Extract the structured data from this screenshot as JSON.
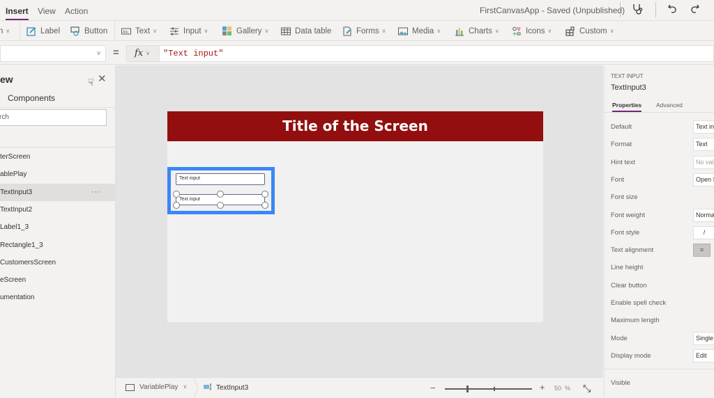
{
  "menu": {
    "tabs": [
      {
        "label": "Insert",
        "active": true
      },
      {
        "label": "View",
        "active": false
      },
      {
        "label": "Action",
        "active": false
      }
    ],
    "app_title": "FirstCanvasApp - Saved (Unpublished)",
    "icons": [
      "stethoscope-icon",
      "undo-icon",
      "redo-icon"
    ]
  },
  "ribbon": {
    "items": [
      {
        "label": "n",
        "dropdown": true,
        "icon": "new-screen-icon"
      },
      {
        "label": "Label",
        "dropdown": false,
        "icon": "label-icon"
      },
      {
        "label": "Button",
        "dropdown": false,
        "icon": "button-icon"
      },
      {
        "label": "Text",
        "dropdown": true,
        "icon": "text-icon"
      },
      {
        "label": "Input",
        "dropdown": true,
        "icon": "input-icon"
      },
      {
        "label": "Gallery",
        "dropdown": true,
        "icon": "gallery-icon"
      },
      {
        "label": "Data table",
        "dropdown": false,
        "icon": "data-table-icon"
      },
      {
        "label": "Forms",
        "dropdown": true,
        "icon": "forms-icon"
      },
      {
        "label": "Media",
        "dropdown": true,
        "icon": "media-icon"
      },
      {
        "label": "Charts",
        "dropdown": true,
        "icon": "charts-icon"
      },
      {
        "label": "Icons",
        "dropdown": true,
        "icon": "icons-icon"
      },
      {
        "label": "Custom",
        "dropdown": true,
        "icon": "custom-icon"
      }
    ]
  },
  "formula_bar": {
    "property_value": "",
    "equals": "=",
    "fx_label": "fx",
    "formula": "\"Text input\""
  },
  "tree_view": {
    "title": "ew",
    "tab_components": "Components",
    "search_placeholder": "rch",
    "items": [
      {
        "label": "terScreen",
        "selected": false
      },
      {
        "label": "ablePlay",
        "selected": false
      },
      {
        "label": "TextInput3",
        "selected": true
      },
      {
        "label": "TextInput2",
        "selected": false
      },
      {
        "label": "Label1_3",
        "selected": false
      },
      {
        "label": "Rectangle1_3",
        "selected": false
      },
      {
        "label": "CustomersScreen",
        "selected": false
      },
      {
        "label": "eScreen",
        "selected": false
      },
      {
        "label": "umentation",
        "selected": false
      }
    ],
    "more_label": "···"
  },
  "canvas": {
    "screen_title": "Title of the Screen",
    "title_color": "#930e0e",
    "selection_color": "#3b87f5",
    "text_input_1": "Text input",
    "text_input_2": "Text input"
  },
  "status_bar": {
    "screen_name": "VariablePlay",
    "selected_control": "TextInput3",
    "zoom_value": "50",
    "zoom_unit": "%",
    "zoom_percent": 50
  },
  "properties": {
    "control_type": "TEXT INPUT",
    "control_name": "TextInput3",
    "tabs": [
      {
        "label": "Properties",
        "active": true
      },
      {
        "label": "Advanced",
        "active": false
      }
    ],
    "rows": [
      {
        "label": "Default",
        "value": "Text in",
        "kind": "input"
      },
      {
        "label": "Format",
        "value": "Text",
        "kind": "input"
      },
      {
        "label": "Hint text",
        "value": "No val",
        "kind": "placeholder"
      },
      {
        "label": "Font",
        "value": "Open S",
        "kind": "input"
      },
      {
        "label": "Font size",
        "value": "",
        "kind": "none"
      },
      {
        "label": "Font weight",
        "value": "Norma",
        "kind": "input"
      },
      {
        "label": "Font style",
        "value": "/",
        "kind": "input"
      },
      {
        "label": "Text alignment",
        "value": "≡",
        "kind": "align"
      },
      {
        "label": "Line height",
        "value": "",
        "kind": "none"
      },
      {
        "label": "Clear button",
        "value": "",
        "kind": "none"
      },
      {
        "label": "Enable spell check",
        "value": "",
        "kind": "none"
      },
      {
        "label": "Maximum length",
        "value": "",
        "kind": "none"
      },
      {
        "label": "Mode",
        "value": "Single",
        "kind": "input"
      },
      {
        "label": "Display mode",
        "value": "Edit",
        "kind": "input"
      }
    ],
    "visible_label": "Visible"
  }
}
